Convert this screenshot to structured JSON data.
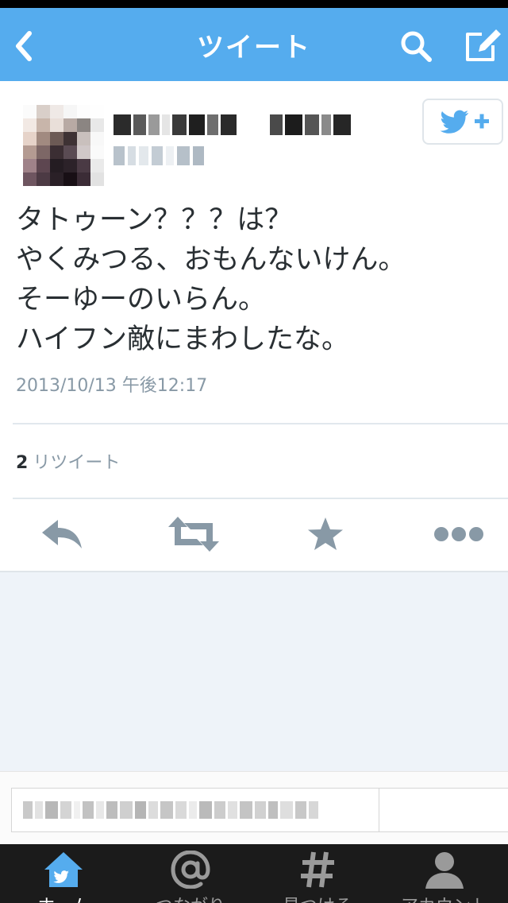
{
  "nav": {
    "title": "ツイート",
    "back_icon": "chevron-left-icon",
    "search_icon": "search-icon",
    "compose_icon": "compose-icon"
  },
  "tweet": {
    "lines": [
      "タトゥーン？？？は？",
      "やくみつる、おもんないけん。",
      "そーゆーのいらん。",
      "ハイフン敵にまわしたな。"
    ],
    "timestamp": "2013/10/13 午後12:17",
    "retweet_count": "2",
    "retweet_label": "リツイート",
    "follow_icon": "follow-user-icon"
  },
  "actions": [
    {
      "name": "reply",
      "icon": "reply-icon"
    },
    {
      "name": "retweet",
      "icon": "retweet-icon"
    },
    {
      "name": "favorite",
      "icon": "star-icon"
    },
    {
      "name": "more",
      "icon": "more-icon"
    }
  ],
  "tabs": [
    {
      "label": "ホーム",
      "icon": "home-icon",
      "active": true
    },
    {
      "label": "つながり",
      "icon": "at-icon",
      "active": false
    },
    {
      "label": "見つける",
      "icon": "hashtag-icon",
      "active": false
    },
    {
      "label": "アカウント",
      "icon": "person-icon",
      "active": false
    }
  ],
  "colors": {
    "brand": "#55acee",
    "icon_gray": "#8899a6",
    "tab_bar": "#1b1b1b",
    "background": "#eef3f9"
  }
}
